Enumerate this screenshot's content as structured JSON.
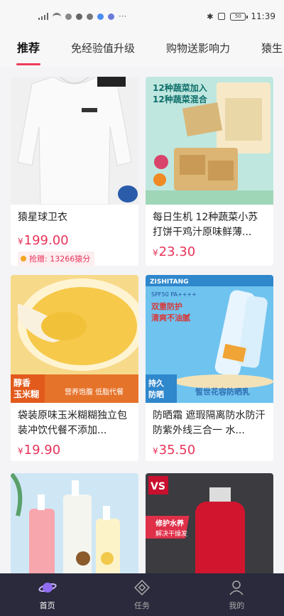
{
  "status_bar": {
    "time": "11:39",
    "battery": "50"
  },
  "tabs": [
    {
      "label": "推荐",
      "active": true
    },
    {
      "label": "免经验值升级",
      "active": false
    },
    {
      "label": "购物送影响力",
      "active": false
    },
    {
      "label": "猿生",
      "active": false
    }
  ],
  "products": [
    {
      "title": "猿星球卫衣",
      "currency": "¥",
      "price": "199.00",
      "badge": "抢赠: 13266猿分"
    },
    {
      "title": "每日生机 12种蔬菜小苏打饼干鸡汁原味鲜薄...",
      "currency": "¥",
      "price": "23.30",
      "image_text": [
        "12种蔬菜加入",
        "12种蔬菜混合"
      ]
    },
    {
      "title": "袋装原味玉米糊糊独立包装冲饮代餐不添加...",
      "currency": "¥",
      "price": "19.90",
      "image_text": [
        "醇香",
        "玉米糊",
        "营养饱腹 低脂代餐"
      ]
    },
    {
      "title": "防晒霜 遮瑕隔离防水防汗防紫外线三合一 水...",
      "currency": "¥",
      "price": "35.50",
      "image_text": [
        "ZISHITANG",
        "SPF50 PA++++",
        "双重防护",
        "清爽不油腻",
        "持久",
        "防晒",
        "皙世花容防晒乳"
      ]
    },
    {
      "title": "",
      "currency": "",
      "price": ""
    },
    {
      "title": "",
      "currency": "",
      "price": "",
      "image_text": [
        "VS",
        "修护水养",
        "解决干燥发"
      ]
    }
  ],
  "nav": [
    {
      "label": "首页",
      "icon": "planet-icon",
      "active": true
    },
    {
      "label": "任务",
      "icon": "task-diamond-icon",
      "active": false
    },
    {
      "label": "我的",
      "icon": "person-icon",
      "active": false
    }
  ],
  "colors": {
    "accent": "#e8335a",
    "nav_bg": "#2a2a3c"
  }
}
